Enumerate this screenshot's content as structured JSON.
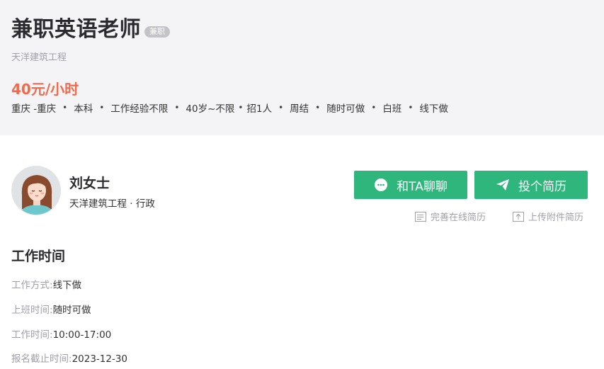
{
  "job": {
    "title": "兼职英语老师",
    "tag": "兼职",
    "company": "天洋建筑工程",
    "salary": "40元/小时",
    "location": "重庆 -重庆",
    "education": "本科",
    "experience": "工作经验不限",
    "age": "40岁~不限",
    "headcount": "招1人",
    "settlement": "周结",
    "availability": "随时可做",
    "shift": "白班",
    "mode": "线下做"
  },
  "recruiter": {
    "name": "刘女士",
    "company_role": "天洋建筑工程 · 行政"
  },
  "actions": {
    "chat_label": "和TA聊聊",
    "resume_label": "投个简历",
    "online_resume_label": "完善在线简历",
    "upload_resume_label": "上传附件简历"
  },
  "work_time": {
    "title": "工作时间",
    "rows": [
      {
        "label": "工作方式:",
        "value": "线下做"
      },
      {
        "label": "上班时间:",
        "value": "随时可做"
      },
      {
        "label": "工作时间:",
        "value": "10:00-17:00"
      },
      {
        "label": "报名截止时间:",
        "value": "2023-12-30"
      }
    ]
  },
  "colors": {
    "accent_green": "#2eb67d",
    "salary_orange": "#f26a4b",
    "header_bg": "#f4f4f7"
  },
  "icons": {
    "chat": "chat-bubble-icon",
    "resume": "paper-plane-icon",
    "online_resume": "document-icon",
    "upload_resume": "upload-icon"
  }
}
